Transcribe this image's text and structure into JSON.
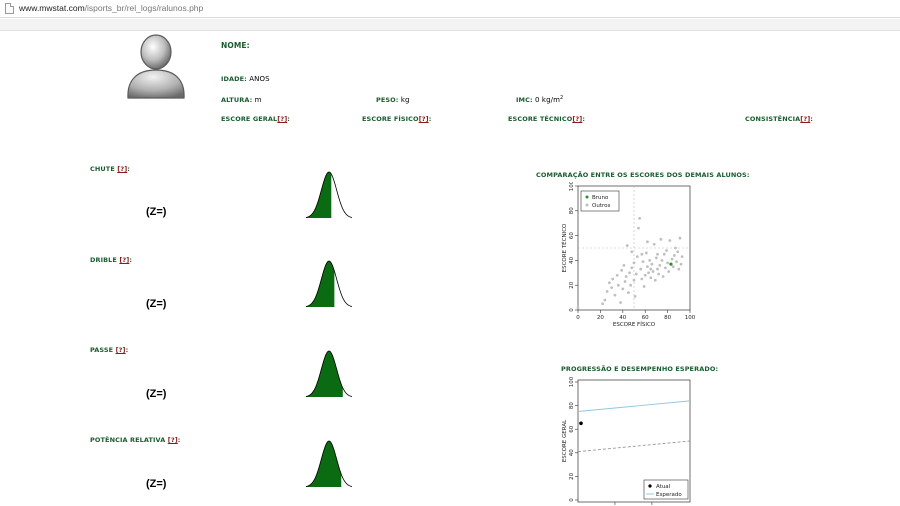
{
  "browser": {
    "url_host": "www.mwstat.com",
    "url_path": "/isports_br/rel_logs/ralunos.php"
  },
  "profile": {
    "name_label": "NOME:",
    "age_label": "IDADE:",
    "age_unit": "ANOS",
    "height_label": "ALTURA:",
    "height_unit": "m",
    "weight_label": "PESO:",
    "weight_unit": "kg",
    "bmi_label": "IMC:",
    "bmi_value": "0 kg/m",
    "bmi_exp": "2"
  },
  "scores": {
    "general_label": "ESCORE GERAL",
    "physical_label": "ESCORE FÍSICO",
    "technical_label": "ESCORE TÉCNICO",
    "consistency_label": "CONSISTÊNCIA",
    "help_link": "[?]",
    "colon": ":"
  },
  "skills": [
    {
      "label": "CHUTE",
      "z": "(Z=)"
    },
    {
      "label": "DRIBLE",
      "z": "(Z=)"
    },
    {
      "label": "PASSE",
      "z": "(Z=)"
    },
    {
      "label": "POTÊNCIA RELATIVA",
      "z": "(Z=)"
    }
  ],
  "skill_help": "[?]",
  "colors": {
    "label_green": "#1a5c2e",
    "curve_fill": "#0b6b12",
    "help_red": "#8b1a1a"
  },
  "charts": {
    "comparison_title": "COMPARAÇÃO ENTRE OS ESCORES DOS DEMAIS ALUNOS:",
    "progression_title": "PROGRESSÃO E DESEMPENHO ESPERADO:"
  },
  "chart_data": [
    {
      "type": "scatter",
      "xlabel": "ESCORE FÍSICO",
      "ylabel": "ESCORE TÉCNICO",
      "xlim": [
        0,
        100
      ],
      "ylim": [
        0,
        100
      ],
      "xticks": [
        "0",
        "20",
        "40",
        "60",
        "80",
        "100"
      ],
      "yticks": [
        "0",
        "20",
        "40",
        "60",
        "80",
        "100"
      ],
      "reference_lines": {
        "x": 50,
        "y": 50
      },
      "legend_position": "top-left",
      "series": [
        {
          "name": "Bruno",
          "color": "#2e8b2e",
          "points": [
            [
              83,
              37
            ]
          ]
        },
        {
          "name": "Outros",
          "color": "#c0c0c0",
          "points": [
            [
              0,
              2
            ],
            [
              22,
              5
            ],
            [
              24,
              8
            ],
            [
              26,
              15
            ],
            [
              28,
              22
            ],
            [
              30,
              18
            ],
            [
              31,
              25
            ],
            [
              33,
              12
            ],
            [
              35,
              28
            ],
            [
              36,
              20
            ],
            [
              38,
              6
            ],
            [
              39,
              32
            ],
            [
              40,
              17
            ],
            [
              41,
              36
            ],
            [
              42,
              23
            ],
            [
              43,
              27
            ],
            [
              44,
              52
            ],
            [
              45,
              14
            ],
            [
              46,
              30
            ],
            [
              47,
              20
            ],
            [
              48,
              34
            ],
            [
              50,
              24
            ],
            [
              50,
              38
            ],
            [
              51,
              11
            ],
            [
              52,
              29
            ],
            [
              53,
              43
            ],
            [
              54,
              66
            ],
            [
              55,
              74
            ],
            [
              56,
              33
            ],
            [
              57,
              25
            ],
            [
              58,
              39
            ],
            [
              59,
              19
            ],
            [
              60,
              28
            ],
            [
              61,
              46
            ],
            [
              62,
              35
            ],
            [
              63,
              30
            ],
            [
              64,
              40
            ],
            [
              65,
              26
            ],
            [
              66,
              37
            ],
            [
              67,
              31
            ],
            [
              68,
              53
            ],
            [
              69,
              24
            ],
            [
              70,
              42
            ],
            [
              71,
              33
            ],
            [
              72,
              29
            ],
            [
              73,
              36
            ],
            [
              74,
              57
            ],
            [
              75,
              40
            ],
            [
              76,
              27
            ],
            [
              77,
              45
            ],
            [
              78,
              34
            ],
            [
              79,
              48
            ],
            [
              80,
              38
            ],
            [
              81,
              31
            ],
            [
              82,
              56
            ],
            [
              84,
              41
            ],
            [
              85,
              35
            ],
            [
              86,
              44
            ],
            [
              87,
              50
            ],
            [
              88,
              39
            ],
            [
              89,
              47
            ],
            [
              90,
              33
            ],
            [
              91,
              58
            ],
            [
              92,
              37
            ],
            [
              93,
              43
            ],
            [
              62,
              55
            ],
            [
              57,
              45
            ],
            [
              48,
              47
            ],
            [
              65,
              33
            ],
            [
              71,
              45
            ]
          ]
        }
      ]
    },
    {
      "type": "line",
      "xlabel": "",
      "ylabel": "ESCORE GERAL",
      "ylim": [
        0,
        100
      ],
      "yticks": [
        "0",
        "20",
        "40",
        "60",
        "80",
        "100"
      ],
      "x": [
        0,
        1
      ],
      "legend_position": "bottom-right",
      "points": [
        {
          "name": "Atual",
          "x": 0,
          "y": 65,
          "color": "#000000"
        }
      ],
      "series": [
        {
          "name": "Esperado",
          "color": "#8fc8e0",
          "dash": false,
          "values": [
            75,
            84
          ]
        },
        {
          "dash": true,
          "color": "#999999",
          "values": [
            41,
            50
          ]
        }
      ]
    }
  ]
}
